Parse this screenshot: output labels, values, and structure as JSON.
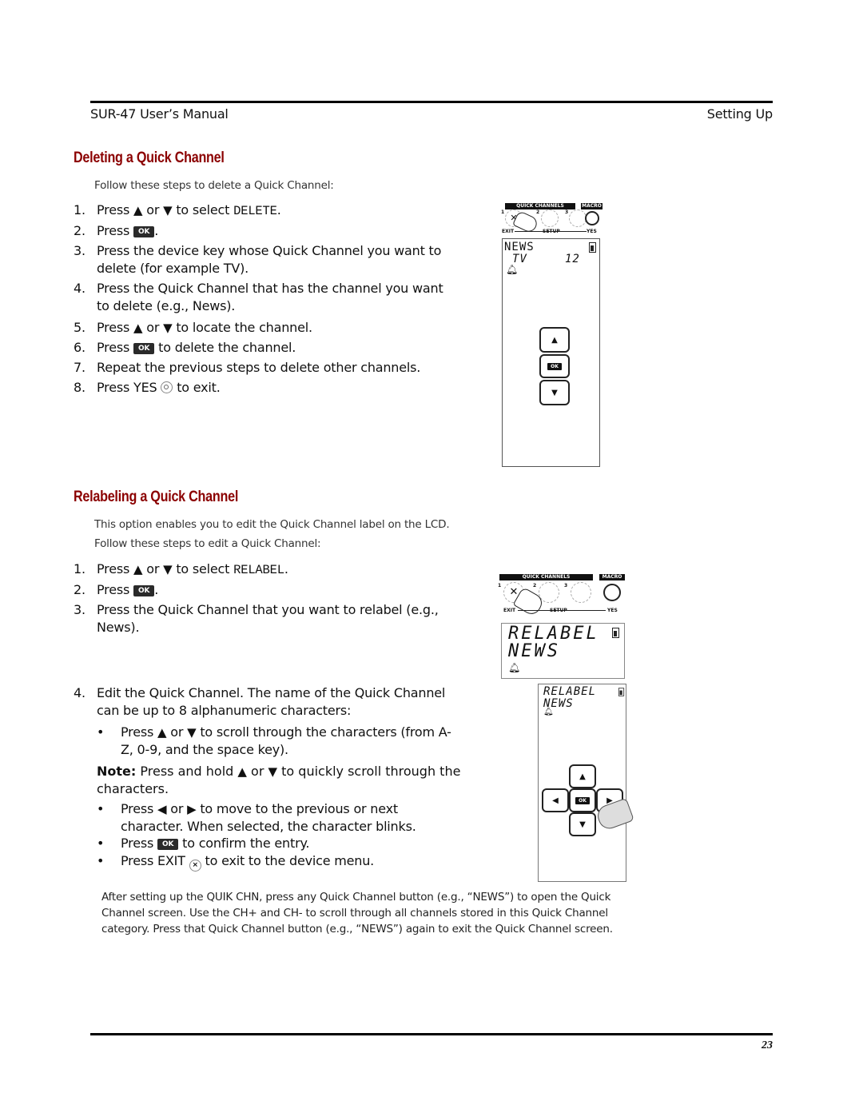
{
  "header": {
    "left": "SUR-47 User’s Manual",
    "right": "Setting Up"
  },
  "footer": {
    "page_number": "23"
  },
  "deleting": {
    "title": "Deleting a Quick Channel",
    "intro": "Follow these steps to delete a Quick Channel:",
    "steps": [
      {
        "num": "1.",
        "pre": "Press",
        "up": "▲",
        "or": "or",
        "down": "▼",
        "post": "to select",
        "code": "DELETE",
        "end": "."
      },
      {
        "num": "2.",
        "pre": "Press",
        "ok": "OK",
        "end": "."
      },
      {
        "num": "3.",
        "text": "Press the device key whose Quick Channel you want to delete (for example TV)."
      },
      {
        "num": "4.",
        "text": "Press the Quick Channel that has the channel you want to delete (e.g., News)."
      },
      {
        "num": "5.",
        "pre": "Press",
        "up": "▲",
        "or": "or",
        "down": "▼",
        "post": "to locate the channel."
      },
      {
        "num": "6.",
        "pre": "Press",
        "ok": "OK",
        "post": "to delete the channel."
      },
      {
        "num": "7.",
        "text": "Repeat the previous steps to delete other channels."
      },
      {
        "num": "8.",
        "pre": "Press YES",
        "post": "to exit."
      }
    ],
    "illustration": {
      "quick_channels_label": "QUICK CHANNELS",
      "macro_label": "MACRO",
      "btn_numbers": [
        "1",
        "2",
        "3"
      ],
      "exit_label": "EXIT",
      "setup_label": "SETUP",
      "yes_label": "YES",
      "lcd_line1": "NEWS",
      "lcd_line2_left": "TV",
      "lcd_line2_right": "12",
      "pad_up": "▲",
      "pad_ok": "OK",
      "pad_down": "▼"
    }
  },
  "relabeling": {
    "title": "Relabeling a Quick Channel",
    "intro1": "This option enables you to edit the Quick Channel label on the LCD.",
    "intro2": "Follow these steps to edit a Quick Channel:",
    "steps": [
      {
        "num": "1.",
        "pre": "Press",
        "up": "▲",
        "or": "or",
        "down": "▼",
        "post": "to select",
        "code": "RELABEL",
        "end": "."
      },
      {
        "num": "2.",
        "pre": "Press",
        "ok": "OK",
        "end": "."
      },
      {
        "num": "3.",
        "text": "Press the Quick Channel that you want to relabel (e.g., News)."
      },
      {
        "num": "4.",
        "text": "Edit the Quick Channel. The name of the Quick Channel can be up to 8 alphanumeric characters:"
      }
    ],
    "bullets": [
      {
        "pre": "Press",
        "up": "▲",
        "or": "or",
        "down": "▼",
        "post": "to scroll through the characters (from A-Z, 0-9, and the space key)."
      },
      {
        "pre": "Press",
        "left": "◀",
        "or": "or",
        "right": "▶",
        "post": "to move to the previous or next character. When selected, the character blinks."
      },
      {
        "pre": "Press",
        "ok": "OK",
        "post": "to confirm the entry."
      },
      {
        "pre": "Press EXIT",
        "post": "to exit to the device menu."
      }
    ],
    "note": {
      "label": "Note:",
      "pre": "Press and hold",
      "up": "▲",
      "or": "or",
      "down": "▼",
      "post": "to quickly scroll through the characters."
    },
    "illustration1": {
      "quick_channels_label": "QUICK CHANNELS",
      "macro_label": "MACRO",
      "btn_numbers": [
        "1",
        "2",
        "3"
      ],
      "exit_label": "EXIT",
      "setup_label": "SETUP",
      "yes_label": "YES",
      "lcd_line1": "RELABEL",
      "lcd_line2": "NEWS"
    },
    "illustration2": {
      "lcd_line1": "RELABEL",
      "lcd_line2": "NEWS",
      "pad_up": "▲",
      "pad_left": "◀",
      "pad_ok": "OK",
      "pad_right": "▶",
      "pad_down": "▼"
    }
  },
  "after_note": "After setting up the QUIK CHN, press any Quick Channel button (e.g., “NEWS”) to open the Quick Channel screen.  Use the CH+ and CH- to scroll through all channels stored in this Quick Channel category. Press that Quick Channel button (e.g., “NEWS”)  again to exit the Quick Channel screen."
}
